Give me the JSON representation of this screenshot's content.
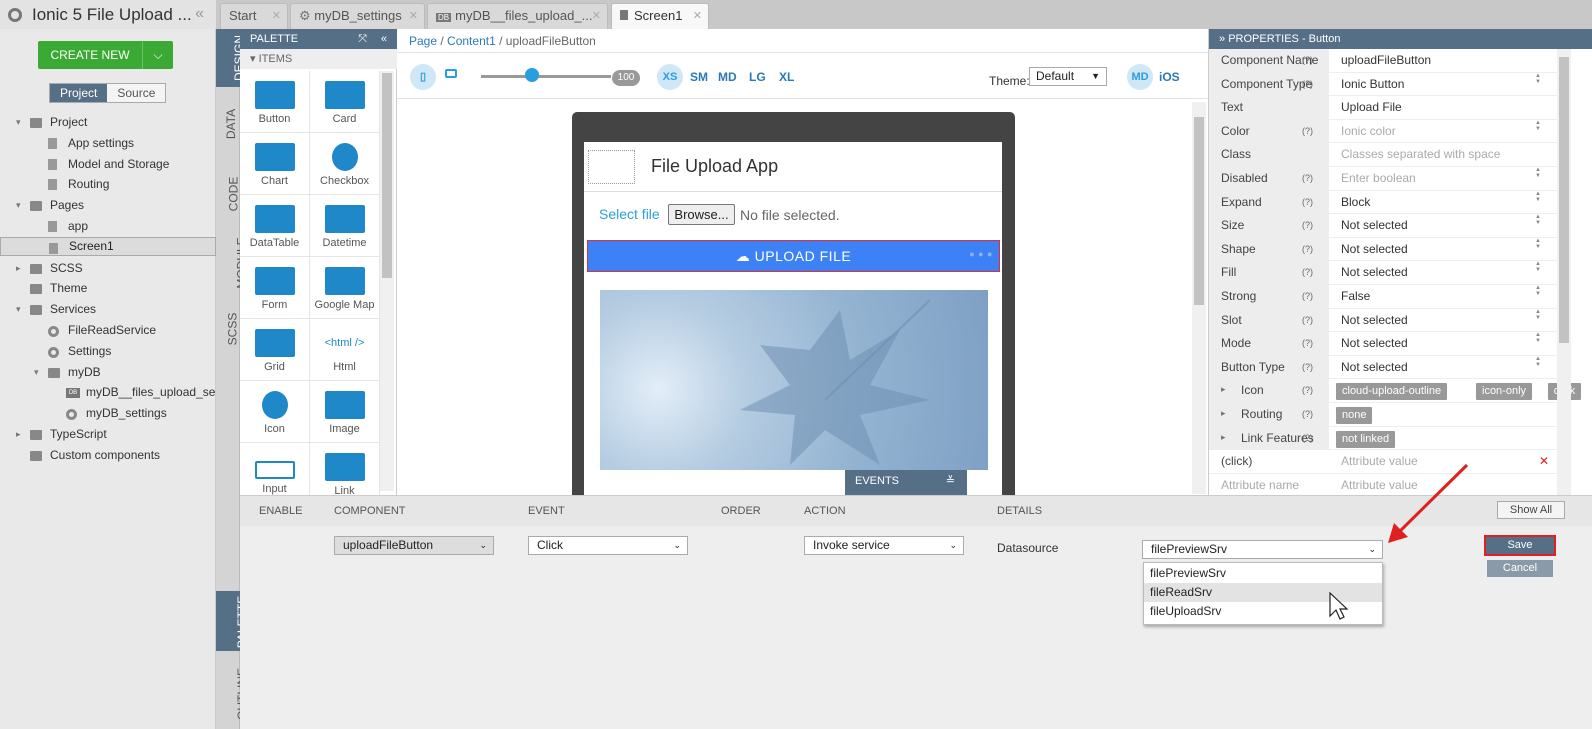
{
  "app": {
    "title": "Ionic 5 File Upload ...",
    "create_new": "CREATE NEW",
    "view_project": "Project",
    "view_source": "Source"
  },
  "tree": [
    {
      "label": "Project",
      "icon": "folder-icon",
      "expanded": true
    },
    {
      "label": "App settings",
      "icon": "file-icon"
    },
    {
      "label": "Model and Storage",
      "icon": "file-icon"
    },
    {
      "label": "Routing",
      "icon": "file-icon"
    },
    {
      "label": "Pages",
      "icon": "folder-icon",
      "expanded": true
    },
    {
      "label": "app",
      "icon": "page-icon"
    },
    {
      "label": "Screen1",
      "icon": "page-icon",
      "selected": true
    },
    {
      "label": "SCSS",
      "icon": "folder-icon"
    },
    {
      "label": "Theme",
      "icon": "folder-icon"
    },
    {
      "label": "Services",
      "icon": "folder-icon",
      "expanded": true
    },
    {
      "label": "FileReadService",
      "icon": "gear-icon"
    },
    {
      "label": "Settings",
      "icon": "gear-icon"
    },
    {
      "label": "myDB",
      "icon": "folder-icon",
      "expanded": true
    },
    {
      "label": "myDB__files_upload_servi...",
      "icon": "db-icon"
    },
    {
      "label": "myDB_settings",
      "icon": "gear-icon"
    },
    {
      "label": "TypeScript",
      "icon": "folder-icon"
    },
    {
      "label": "Custom components",
      "icon": "folder-icon"
    }
  ],
  "tabs": [
    {
      "label": "Start"
    },
    {
      "label": "myDB_settings"
    },
    {
      "label": "myDB__files_upload_..."
    },
    {
      "label": "Screen1",
      "active": true
    }
  ],
  "vtabs": {
    "design": "DESIGN",
    "data": "DATA",
    "code": "CODE",
    "module": "MODULE",
    "scss": "SCSS",
    "palette": "PALETTE",
    "outline": "OUTLINE"
  },
  "palette": {
    "title": "PALETTE",
    "section": "ITEMS",
    "items": [
      "Button",
      "Card",
      "Chart",
      "Checkbox",
      "DataTable",
      "Datetime",
      "Form",
      "Google Map",
      "Grid",
      "Html",
      "Icon",
      "Image",
      "Input",
      "Link"
    ]
  },
  "breadcrumb": [
    "Page",
    "Content1",
    "uploadFileButton"
  ],
  "toolbar": {
    "zoom": "100",
    "sizes": [
      "XS",
      "SM",
      "MD",
      "LG",
      "XL"
    ],
    "theme_label": "Theme:",
    "theme_value": "Default",
    "mode_md": "MD",
    "mode_ios": "iOS"
  },
  "screen": {
    "title": "File Upload App",
    "select_file": "Select file",
    "browse": "Browse...",
    "no_file": "No file selected.",
    "upload_button": "UPLOAD FILE"
  },
  "events_panel": {
    "title": "EVENTS",
    "columns": [
      "ENABLE",
      "COMPONENT",
      "EVENT",
      "ORDER",
      "ACTION",
      "DETAILS"
    ],
    "component": "uploadFileButton",
    "event": "Click",
    "action": "Invoke service",
    "details_label": "Datasource",
    "datasource": "filePreviewSrv",
    "options": [
      "filePreviewSrv",
      "fileReadSrv",
      "fileUploadSrv"
    ],
    "highlighted_option": "fileReadSrv",
    "show_all": "Show All",
    "save": "Save",
    "cancel": "Cancel"
  },
  "properties": {
    "title": "PROPERTIES - Button",
    "rows": [
      {
        "key": "Component Name",
        "help": "(?)",
        "value": "uploadFileButton"
      },
      {
        "key": "Component Type",
        "help": "(?)",
        "value": "Ionic Button"
      },
      {
        "key": "Text",
        "help": "",
        "value": "Upload File"
      },
      {
        "key": "Color",
        "help": "(?)",
        "value": "Ionic color",
        "placeholder": true
      },
      {
        "key": "Class",
        "help": "",
        "value": "Classes separated with space",
        "placeholder": true
      },
      {
        "key": "Disabled",
        "help": "(?)",
        "value": "Enter boolean",
        "placeholder": true
      },
      {
        "key": "Expand",
        "help": "(?)",
        "value": "Block"
      },
      {
        "key": "Size",
        "help": "(?)",
        "value": "Not selected"
      },
      {
        "key": "Shape",
        "help": "(?)",
        "value": "Not selected"
      },
      {
        "key": "Fill",
        "help": "(?)",
        "value": "Not selected"
      },
      {
        "key": "Strong",
        "help": "(?)",
        "value": "False"
      },
      {
        "key": "Slot",
        "help": "(?)",
        "value": "Not selected"
      },
      {
        "key": "Mode",
        "help": "(?)",
        "value": "Not selected"
      },
      {
        "key": "Button Type",
        "help": "(?)",
        "value": "Not selected"
      }
    ],
    "icon_row": {
      "key": "Icon",
      "help": "(?)",
      "tags": [
        "cloud-upload-outline",
        "icon-only",
        "dark"
      ]
    },
    "routing_row": {
      "key": "Routing",
      "help": "(?)",
      "tags": [
        "none"
      ]
    },
    "link_row": {
      "key": "Link Features",
      "help": "(?)",
      "tags": [
        "not linked"
      ]
    },
    "click_row": {
      "key": "(click)",
      "value": "Attribute value"
    },
    "attr_row": {
      "key": "Attribute name",
      "value": "Attribute value"
    }
  },
  "colors": {
    "accent": "#556f86",
    "create": "#3aaa35",
    "upload_button": "#3c82f6",
    "save_border": "#e0201e",
    "arrow": "#e0201e"
  }
}
